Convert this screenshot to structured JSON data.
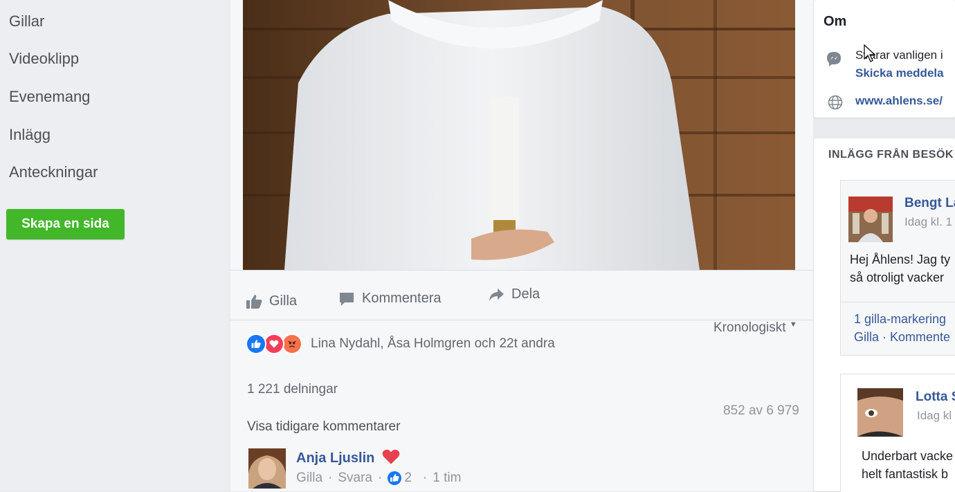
{
  "left_nav": {
    "items": [
      "Gillar",
      "Videoklipp",
      "Evenemang",
      "Inlägg",
      "Anteckningar"
    ],
    "create_page_button": "Skapa en sida"
  },
  "post": {
    "actions": {
      "like": "Gilla",
      "comment": "Kommentera",
      "share": "Dela"
    },
    "reactions_text": "Lina Nydahl, Åsa Holmgren och 22t andra",
    "sort_label": "Kronologiskt",
    "shares_text": "1 221 delningar",
    "view_previous_comments": "Visa tidigare kommentarer",
    "comment_count": "852 av 6 979",
    "comment": {
      "author": "Anja Ljuslin",
      "like": "Gilla",
      "reply": "Svara",
      "likes": "2",
      "time": "1 tim"
    }
  },
  "about": {
    "title": "Om",
    "response_text": "Svarar vanligen i",
    "send_message": "Skicka meddela",
    "website": "www.ahlens.se/"
  },
  "visitor_posts": {
    "title": "INLÄGG FRÅN BESÖK",
    "posts": [
      {
        "name": "Bengt La",
        "time": "Idag kl. 1",
        "text_line1": "Hej Åhlens! Jag ty",
        "text_line2": "så otroligt vacker",
        "likes": "1 gilla-markering",
        "actions": "Gilla · Kommente"
      },
      {
        "name": "Lotta S",
        "time": "Idag kl",
        "text_line1": "Underbart vacke",
        "text_line2": "helt fantastisk b"
      }
    ]
  },
  "colors": {
    "facebook_blue": "#365899",
    "create_button_green": "#42b72a",
    "like_blue": "#1877f2",
    "love_red": "#f33e58",
    "angry_orange": "#f7714c"
  }
}
